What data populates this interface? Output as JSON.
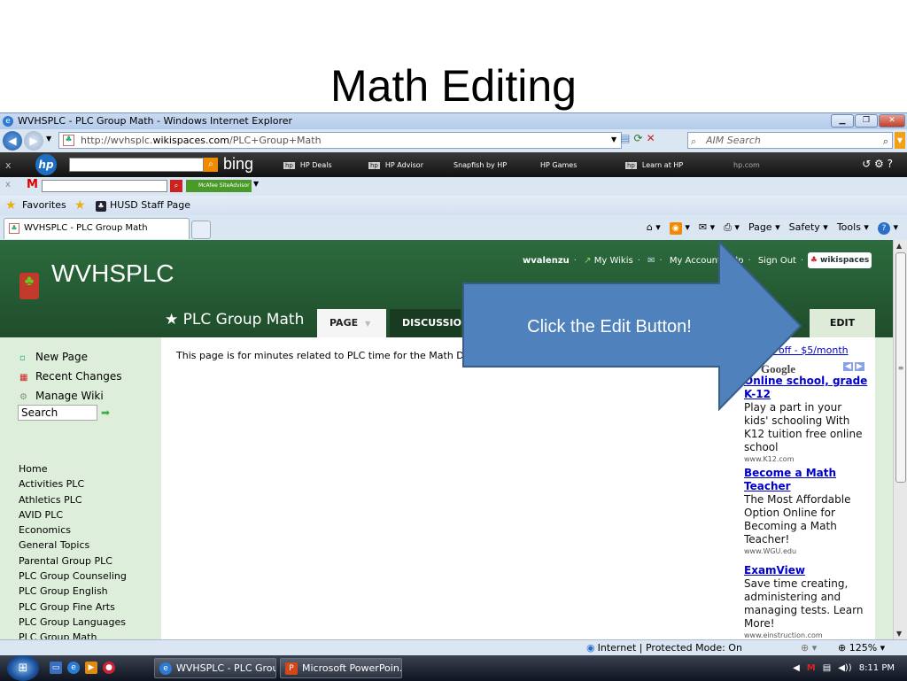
{
  "slide": {
    "title": "Math Editing"
  },
  "window": {
    "title": "WVHSPLC - PLC Group Math - Windows Internet Explorer",
    "buttons": {
      "minimize": "▁",
      "maximize": "❐",
      "close": "✕"
    }
  },
  "address": {
    "url_prefix": "http://wvhsplc.",
    "url_domain": "wikispaces.com",
    "url_path": "/PLC+Group+Math",
    "search_placeholder": "AIM Search"
  },
  "hp_toolbar": {
    "logo": "hp",
    "bing": "bing",
    "links": [
      "HP Deals",
      "HP Advisor",
      "Snapfish by HP",
      "HP Games",
      "Learn at HP"
    ],
    "hpcom": "hp.com"
  },
  "mcafee_toolbar": {
    "logo": "M",
    "siteadvisor": "McAfee SiteAdvisor"
  },
  "favorites_bar": {
    "favorites": "Favorites",
    "item": "HUSD Staff Page"
  },
  "tabs": [
    {
      "label": "WVHSPLC - PLC Group Math"
    }
  ],
  "command_bar": {
    "page": "Page",
    "safety": "Safety",
    "tools": "Tools"
  },
  "wiki": {
    "site_name": "WVHSPLC",
    "user": "wvalenzu",
    "my_wikis": "My Wikis",
    "my_account": "My Account",
    "help": "lp",
    "sign_out": "Sign Out",
    "badge": "wikispaces",
    "space_name": "PLC Group Math",
    "tab_page": "PAGE",
    "tab_discussion": "DISCUSSIO",
    "edit_button": "EDIT",
    "nav": {
      "new_page": "New Page",
      "recent_changes": "Recent Changes",
      "manage_wiki": "Manage Wiki",
      "search": "Search"
    },
    "sidebar_links": [
      "Home",
      "Activities PLC",
      "Athletics PLC",
      "AVID PLC",
      "Economics",
      "General Topics",
      "Parental Group PLC",
      "PLC Group Counseling",
      "PLC Group English",
      "PLC Group Fine Arts",
      "PLC Group Languages",
      "PLC Group Math"
    ],
    "page_text": "This page is for minutes related to PLC time for the Math Depa"
  },
  "ads": {
    "top_link": "ads off - $5/month",
    "ads_by": "by",
    "google": "Google",
    "items": [
      {
        "title": "Online school, grade K-12",
        "body": "Play a part in your kids' schooling With K12 tuition free online school",
        "url": "www.K12.com"
      },
      {
        "title": "Become a Math Teacher",
        "body": "The Most Affordable Option Online for Becoming a Math Teacher!",
        "url": "www.WGU.edu"
      },
      {
        "title": "ExamView",
        "body": "Save time creating, administering and managing tests. Learn More!",
        "url": "www.einstruction.com"
      }
    ]
  },
  "callout": {
    "text": "Click the Edit Button!",
    "color": "#4f81bd"
  },
  "statusbar": {
    "zone": "Internet | Protected Mode: On",
    "zoom": "125%"
  },
  "taskbar": {
    "items": [
      "WVHSPLC - PLC Grou...",
      "Microsoft PowerPoin..."
    ],
    "time": "8:11 PM"
  }
}
